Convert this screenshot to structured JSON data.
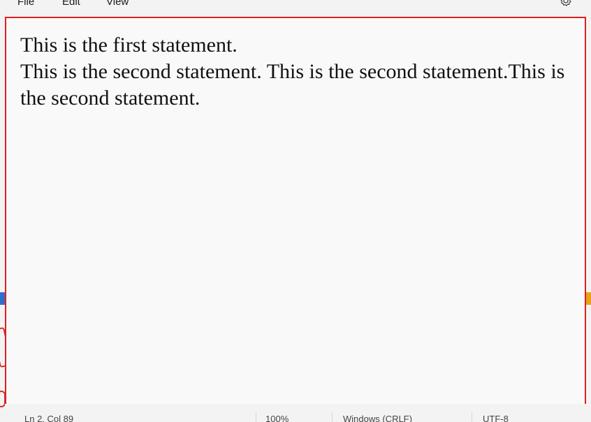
{
  "menu": {
    "file_label": "File",
    "edit_label": "Edit",
    "view_label": "View",
    "settings_icon": "gear-icon"
  },
  "editor": {
    "line1": "This is the first statement.",
    "line2": "This is the second statement. This is the second statement.This is the second statement."
  },
  "status": {
    "position": "Ln 2, Col 89",
    "zoom": "100%",
    "line_ending": "Windows (CRLF)",
    "encoding": "UTF-8"
  },
  "colors": {
    "highlight_border": "#e01f1f",
    "editor_background": "#f9f9f9"
  }
}
